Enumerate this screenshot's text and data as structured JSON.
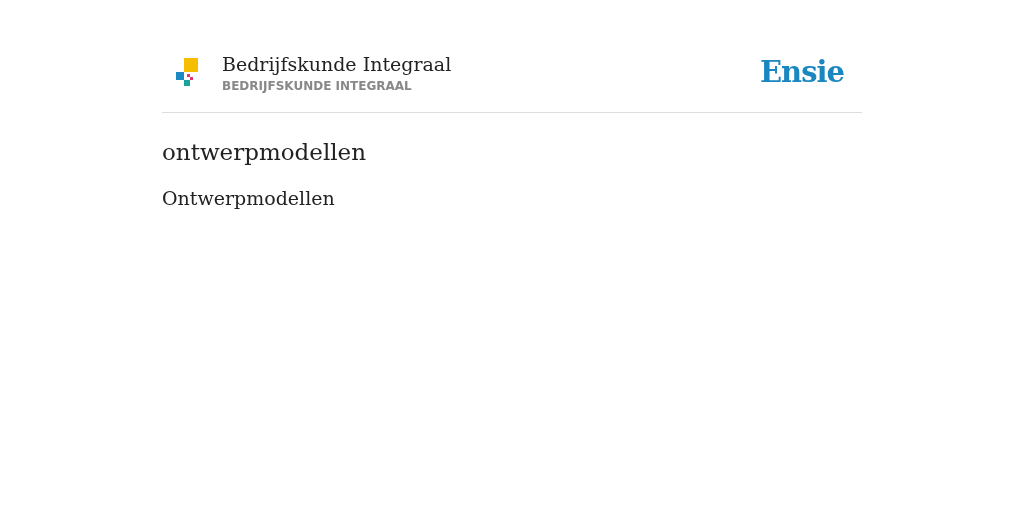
{
  "header": {
    "title": "Bedrijfskunde Integraal",
    "subtitle": "BEDRIJFSKUNDE INTEGRAAL",
    "brand": "Ensie"
  },
  "heading": "ontwerpmodellen",
  "entry": "Ontwerpmodellen"
}
